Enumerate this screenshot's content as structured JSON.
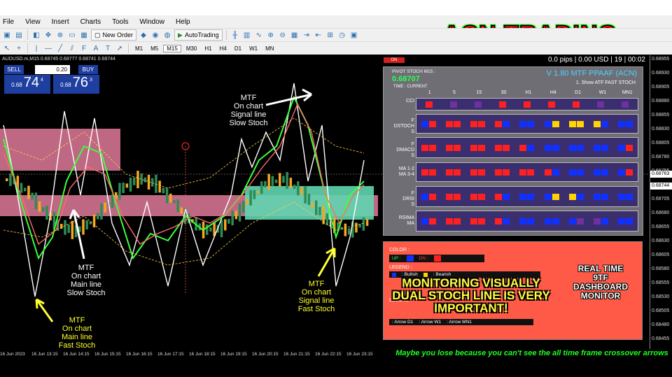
{
  "menu": {
    "items": [
      "File",
      "View",
      "Insert",
      "Charts",
      "Tools",
      "Window",
      "Help"
    ]
  },
  "toolbar": {
    "new_order": "New Order",
    "autotrading": "AutoTrading",
    "timeframes": [
      "M1",
      "M5",
      "M15",
      "M30",
      "H1",
      "H4",
      "D1",
      "W1",
      "MN"
    ]
  },
  "brand": "ACN TRADING",
  "chart": {
    "symbol": "AUDUSD.m,M15  0.68745 0.68777 0.68741 0.68744",
    "price_ticks": [
      "0.68955",
      "0.68930",
      "0.68905",
      "0.68880",
      "0.68855",
      "0.68830",
      "0.68805",
      "0.68780",
      "0.68755",
      "0.68730",
      "0.68705",
      "0.68680",
      "0.68655",
      "0.68630",
      "0.68605",
      "0.68580",
      "0.68555",
      "0.68530",
      "0.68505",
      "0.68480",
      "0.68455"
    ],
    "price_tag_1": "0.68763",
    "price_tag_2": "0.68744",
    "time_ticks": [
      "16 Jun 2023",
      "16 Jun 13:15",
      "16 Jun 14:15",
      "16 Jun 15:15",
      "16 Jun 16:15",
      "16 Jun 17:15",
      "16 Jun 18:15",
      "16 Jun 19:15",
      "16 Jun 20:15",
      "16 Jun 21:15",
      "16 Jun 22:15",
      "16 Jun 23:15"
    ]
  },
  "trade": {
    "sell": "SELL",
    "buy": "BUY",
    "lot": "0.20",
    "sell_prefix": "0.68",
    "sell_big": "74",
    "sell_sup": "4",
    "buy_prefix": "0.68",
    "buy_big": "76",
    "buy_sup": "3"
  },
  "annotations": {
    "slow_signal": [
      "MTF",
      "On chart",
      "Signal line",
      "Slow Stoch"
    ],
    "slow_main": [
      "MTF",
      "On chart",
      "Main line",
      "Slow Stoch"
    ],
    "fast_main": [
      "MTF",
      "On chart",
      "Main line",
      "Fast Stoch"
    ],
    "fast_signal": [
      "MTF",
      "On chart",
      "Signal line",
      "Fast Stoch"
    ]
  },
  "dashboard": {
    "status": "0.0 pips | 0.00 USD | 19 | 00:02",
    "on_label": "ON",
    "pivot_label": "PIVOT STOCH M15 :",
    "pivot_value": "0.68707",
    "time_label": "TIME : CURRENT",
    "version": "V 1.80 MTF PPAAF (ACN)",
    "mode": "1. Show ATF FAST STOCH",
    "timeframes": [
      "1",
      "5",
      "15",
      "30",
      "H1",
      "H4",
      "D1",
      "W1",
      "MN1"
    ],
    "rows": [
      {
        "label": "CCI"
      },
      {
        "label": "F\nDSTOCH\nS"
      },
      {
        "label": "F\nDMACD\nS"
      },
      {
        "label": "MA 1-2\nMA 3-4"
      },
      {
        "label": "F\nDRSI\nS"
      },
      {
        "label": "RSIMA\nMA"
      }
    ]
  },
  "legend": {
    "color": "COLOR :",
    "up": "UP :",
    "dn": "DN :",
    "legend1": "LEGEND :",
    "bullish": ": Bullish",
    "bearish": ": Bearish",
    "legend2": "LEGEND :",
    "arrow_d1": ": Arrow D1",
    "arrow_w1": ": Arrow W1",
    "arrow_mn1": ": Arrow MN1"
  },
  "real_time": "REAL TIME\n9TF\nDASHBOARD\nMONITOR",
  "monitoring": "MONITORING VISUALLY DUAL STOCH LINE IS VERY IMPORTANT!",
  "bottom_note": "Maybe you lose because you can't see the all time frame crossover arrows",
  "colors": {
    "brand_red": "#ff1010",
    "dash_bg": "#6e6e74",
    "panel_bg": "#ff5a47",
    "note_green": "#22ff22"
  }
}
